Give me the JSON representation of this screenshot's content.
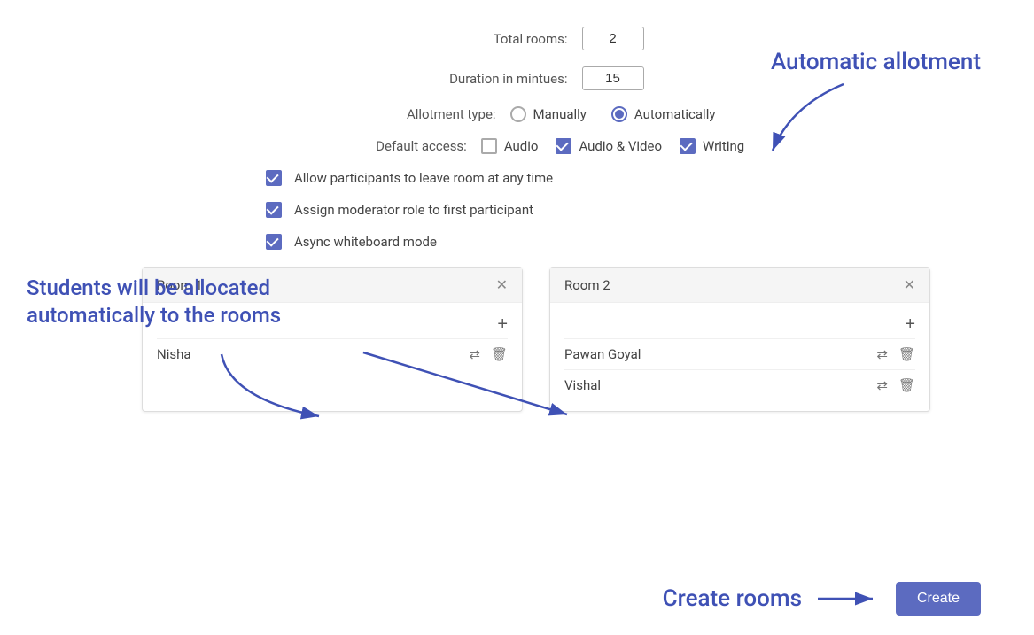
{
  "form": {
    "total_rooms_label": "Total rooms:",
    "total_rooms_value": "2",
    "duration_label": "Duration in mintues:",
    "duration_value": "15",
    "allotment_label": "Allotment type:",
    "allotment_options": [
      {
        "id": "manually",
        "label": "Manually",
        "selected": false
      },
      {
        "id": "automatically",
        "label": "Automatically",
        "selected": true
      }
    ],
    "default_access_label": "Default access:",
    "access_options": [
      {
        "id": "audio",
        "label": "Audio",
        "checked": false
      },
      {
        "id": "audio_video",
        "label": "Audio & Video",
        "checked": true
      },
      {
        "id": "writing",
        "label": "Writing",
        "checked": true
      }
    ],
    "extra_options": [
      {
        "id": "leave",
        "label": "Allow participants to leave room at any time",
        "checked": true
      },
      {
        "id": "moderator",
        "label": "Assign moderator role to first participant",
        "checked": true
      },
      {
        "id": "async",
        "label": "Async whiteboard mode",
        "checked": true
      }
    ]
  },
  "rooms": [
    {
      "id": "room1",
      "title": "Room 1",
      "participants": [
        {
          "name": "Nisha"
        }
      ]
    },
    {
      "id": "room2",
      "title": "Room 2",
      "participants": [
        {
          "name": "Pawan Goyal"
        },
        {
          "name": "Vishal"
        }
      ]
    }
  ],
  "annotations": {
    "auto_allotment_text": "Automatic allotment",
    "students_text_line1": "Students will be allocated",
    "students_text_line2": "automatically to the rooms"
  },
  "bottom": {
    "create_label": "Create rooms",
    "create_button": "Create"
  }
}
